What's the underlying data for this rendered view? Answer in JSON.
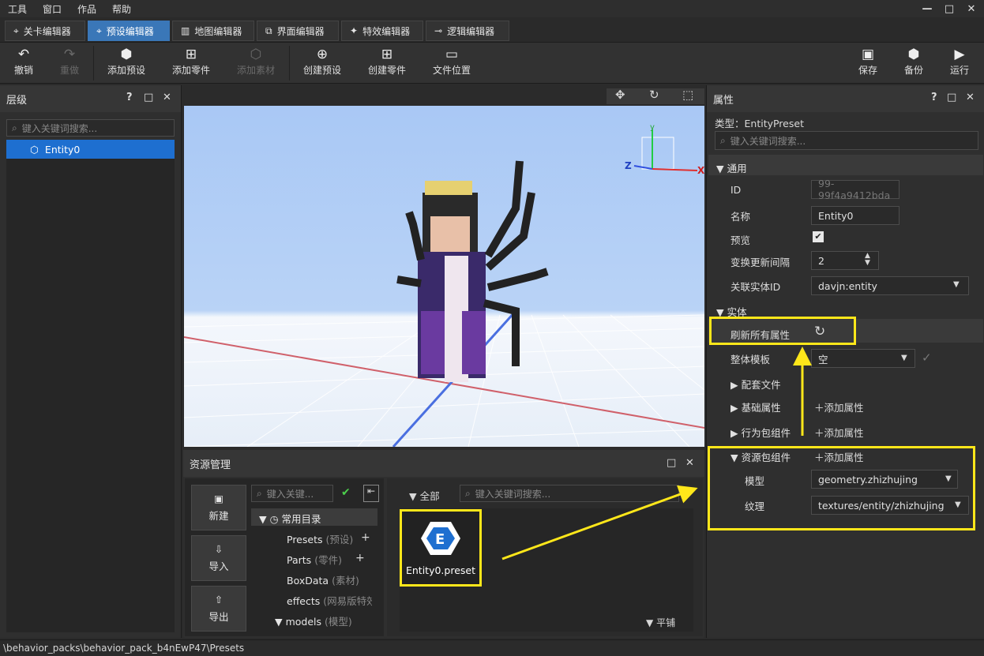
{
  "menu": [
    "工具",
    "窗口",
    "作品",
    "帮助"
  ],
  "editor_tabs": [
    "关卡编辑器",
    "预设编辑器",
    "地图编辑器",
    "界面编辑器",
    "特效编辑器",
    "逻辑编辑器"
  ],
  "toolbar": {
    "undo": "撤销",
    "redo": "重做",
    "add_preset": "添加预设",
    "add_part": "添加零件",
    "add_asset": "添加素材",
    "create_preset": "创建预设",
    "create_part": "创建零件",
    "file_location": "文件位置",
    "save": "保存",
    "backup": "备份",
    "run": "运行"
  },
  "hierarchy": {
    "title": "层级",
    "search_placeholder": "键入关键词搜索...",
    "item": "Entity0"
  },
  "viewport": {
    "axis_y": "y",
    "axis_z": "Z",
    "axis_x": "X"
  },
  "resources": {
    "title": "资源管理",
    "new": "新建",
    "import": "导入",
    "export": "导出",
    "search_placeholder": "键入关键...",
    "all": "全部",
    "search2_placeholder": "键入关键词搜索...",
    "common_dir": "常用目录",
    "presets": "Presets",
    "presets_sub": "(预设)",
    "parts": "Parts",
    "parts_sub": "(零件)",
    "boxdata": "BoxData",
    "boxdata_sub": "(素材)",
    "effects": "effects",
    "effects_sub": "(网易版特效",
    "models": "models",
    "models_sub": "(模型)",
    "file_name": "Entity0.preset",
    "tile": "平铺"
  },
  "properties": {
    "title": "属性",
    "type_line": "类型：EntityPreset",
    "search_placeholder": "键入关键词搜索...",
    "general": "通用",
    "id_label": "ID",
    "id_value": "99-99f4a9412bda",
    "name_label": "名称",
    "name_value": "Entity0",
    "preview_label": "预览",
    "interval_label": "变换更新间隔",
    "interval_value": "2",
    "entity_id_label": "关联实体ID",
    "entity_id_value": "davjn:entity",
    "entity_section": "实体",
    "refresh_label": "刷新所有属性",
    "template_label": "整体模板",
    "template_value": "空",
    "config_files": "配套文件",
    "basic_attrs": "基础属性",
    "behavior_comp": "行为包组件",
    "resource_comp": "资源包组件",
    "add_attr": "添加属性",
    "model_label": "模型",
    "model_value": "geometry.zhizhujing",
    "texture_label": "纹理",
    "texture_value": "textures/entity/zhizhujing"
  },
  "status": {
    "path": "\\behavior_packs\\behavior_pack_b4nEwP47\\Presets"
  },
  "colors": {
    "accent": "#3a77b8",
    "highlight": "#ffe71a",
    "sky": "#a9c8f5"
  }
}
